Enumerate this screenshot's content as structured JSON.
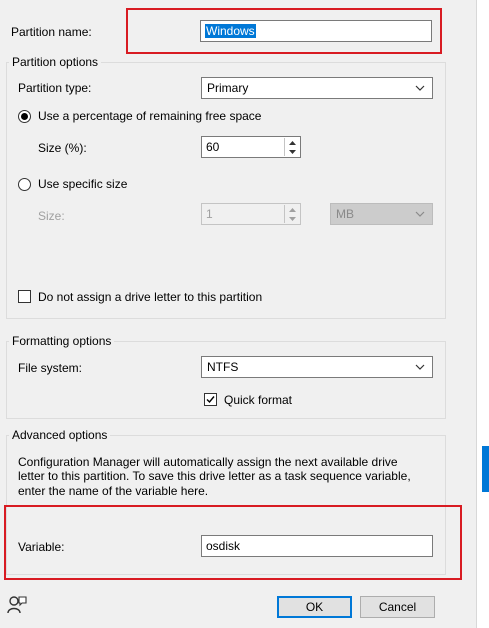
{
  "colors": {
    "accent": "#0078d7",
    "highlight": "#d81b22",
    "background": "#f0f0f0"
  },
  "partition_name": {
    "label": "Partition name:",
    "value": "Windows"
  },
  "partition_options": {
    "title": "Partition options",
    "type_label": "Partition type:",
    "type_value": "Primary",
    "radio_percent_label": "Use a percentage of remaining free space",
    "size_percent_label": "Size (%):",
    "size_percent_value": "60",
    "radio_specific_label": "Use specific size",
    "size_label": "Size:",
    "size_value": "1",
    "size_unit": "MB",
    "no_drive_letter_label": "Do not assign a drive letter to this partition"
  },
  "formatting_options": {
    "title": "Formatting options",
    "fs_label": "File system:",
    "fs_value": "NTFS",
    "quick_format_label": "Quick format"
  },
  "advanced_options": {
    "title": "Advanced options",
    "description_line1": "Configuration Manager will automatically assign the next available drive",
    "description_line2": "letter to this partition. To save this drive letter as a task sequence variable,",
    "description_line3": "enter the name of the variable here.",
    "variable_label": "Variable:",
    "variable_value": "osdisk"
  },
  "buttons": {
    "ok": "OK",
    "cancel": "Cancel"
  },
  "icons": {
    "help": "help-person-icon"
  }
}
